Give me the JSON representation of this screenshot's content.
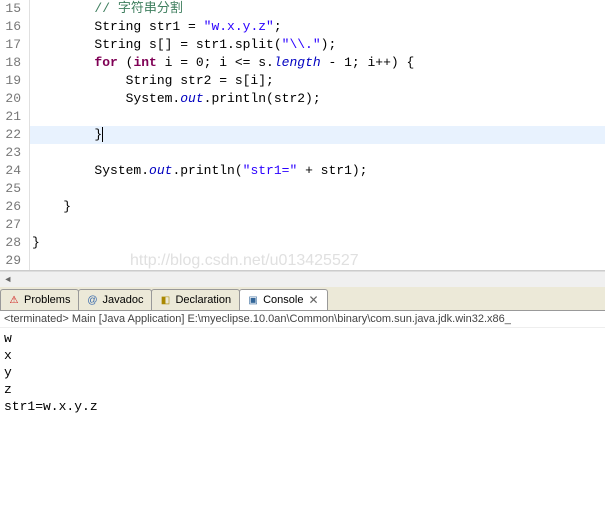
{
  "editor": {
    "lines": [
      {
        "num": 15,
        "html": "        <span class='cmt'>// 字符串分割</span>"
      },
      {
        "num": 16,
        "html": "        String str1 = <span class='str'>\"w.x.y.z\"</span>;"
      },
      {
        "num": 17,
        "html": "        String s[] = str1.split(<span class='str'>\"\\\\.\"</span>);"
      },
      {
        "num": 18,
        "html": "        <span class='kw'>for</span> (<span class='kw'>int</span> i = 0; i &lt;= s.<span class='fld'>length</span> - 1; i++) {"
      },
      {
        "num": 19,
        "html": "            String str2 = s[i];"
      },
      {
        "num": 20,
        "html": "            System.<span class='fld'>out</span>.println(str2);"
      },
      {
        "num": 21,
        "html": ""
      },
      {
        "num": 22,
        "html": "        }<span class='cursor'></span>",
        "hl": true
      },
      {
        "num": 23,
        "html": ""
      },
      {
        "num": 24,
        "html": "        System.<span class='fld'>out</span>.println(<span class='str'>\"str1=\"</span> + str1);"
      },
      {
        "num": 25,
        "html": ""
      },
      {
        "num": 26,
        "html": "    }"
      },
      {
        "num": 27,
        "html": ""
      },
      {
        "num": 28,
        "html": "}"
      },
      {
        "num": 29,
        "html": ""
      }
    ]
  },
  "watermark": "http://blog.csdn.net/u013425527",
  "tabs": {
    "items": [
      {
        "label": "Problems",
        "iconClass": "ic-problems",
        "iconGlyph": "⚠"
      },
      {
        "label": "Javadoc",
        "iconClass": "ic-javadoc",
        "iconGlyph": "@"
      },
      {
        "label": "Declaration",
        "iconClass": "ic-decl",
        "iconGlyph": "◧"
      },
      {
        "label": "Console",
        "iconClass": "ic-console",
        "iconGlyph": "▣",
        "active": true,
        "closable": true
      }
    ]
  },
  "terminated": "<terminated> Main [Java Application] E:\\myeclipse.10.0an\\Common\\binary\\com.sun.java.jdk.win32.x86_",
  "console": {
    "lines": [
      "w",
      "x",
      "y",
      "z",
      "str1=w.x.y.z",
      ""
    ]
  }
}
